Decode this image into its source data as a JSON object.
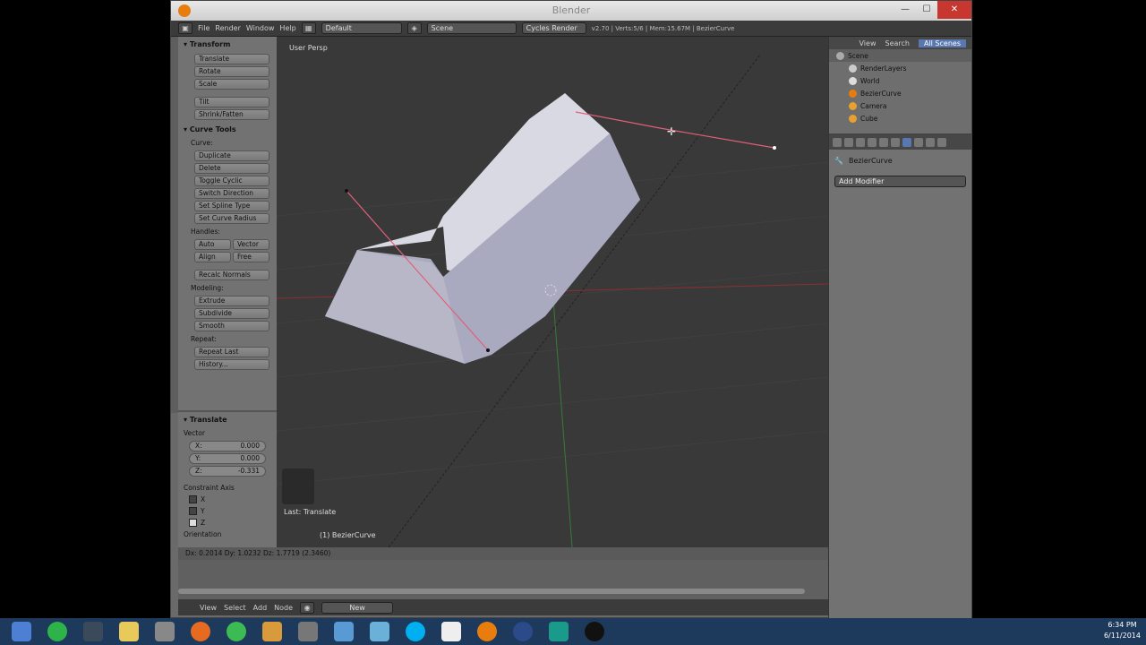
{
  "window": {
    "title": "Blender"
  },
  "infobar": {
    "menus": [
      "File",
      "Render",
      "Window",
      "Help"
    ],
    "layout": "Default",
    "scene": "Scene",
    "engine": "Cycles Render",
    "stats": "v2.70 | Verts:5/6 | Mem:15.67M | BezierCurve"
  },
  "toolshelf": {
    "transform_header": "Transform",
    "transform_buttons": [
      "Translate",
      "Rotate",
      "Scale",
      "Tilt",
      "Shrink/Fatten"
    ],
    "curve_tools_header": "Curve Tools",
    "curve_label": "Curve:",
    "curve_buttons": [
      "Duplicate",
      "Delete",
      "Toggle Cyclic",
      "Switch Direction",
      "Set Spline Type",
      "Set Curve Radius"
    ],
    "handles_label": "Handles:",
    "handles": [
      "Auto",
      "Vector",
      "Align",
      "Free"
    ],
    "recalc": "Recalc Normals",
    "modeling_label": "Modeling:",
    "modeling_buttons": [
      "Extrude",
      "Subdivide",
      "Smooth"
    ],
    "repeat_label": "Repeat:",
    "repeat_buttons": [
      "Repeat Last",
      "History..."
    ]
  },
  "operator": {
    "header": "Translate",
    "vector_label": "Vector",
    "x_label": "X:",
    "x_value": "0.000",
    "y_label": "Y:",
    "y_value": "0.000",
    "z_label": "Z:",
    "z_value": "-0.331",
    "constraint_label": "Constraint Axis",
    "axes": [
      "X",
      "Y",
      "Z"
    ],
    "orientation_label": "Orientation"
  },
  "viewport": {
    "view_label": "User Persp",
    "object_label": "(1) BezierCurve",
    "last_op": "Last: Translate"
  },
  "status": {
    "text": "Dx: 0.2014  Dy: 1.0232  Dz: 1.7719 (2.3460)"
  },
  "outliner": {
    "tabs": [
      "View",
      "Search",
      "All Scenes"
    ],
    "items": [
      "Scene",
      "RenderLayers",
      "World",
      "BezierCurve",
      "Camera",
      "Cube"
    ]
  },
  "properties": {
    "object_name": "BezierCurve",
    "add_modifier": "Add Modifier"
  },
  "bottombar": {
    "menus": [
      "View",
      "Select",
      "Add",
      "Node"
    ],
    "new_label": "New"
  },
  "taskbar": {
    "time": "6:34 PM",
    "date": "6/11/2014"
  },
  "colors": {
    "accent": "#5a78b0",
    "close": "#c7372f",
    "blender_orange": "#e87d0d",
    "curve": "#e0607a"
  }
}
